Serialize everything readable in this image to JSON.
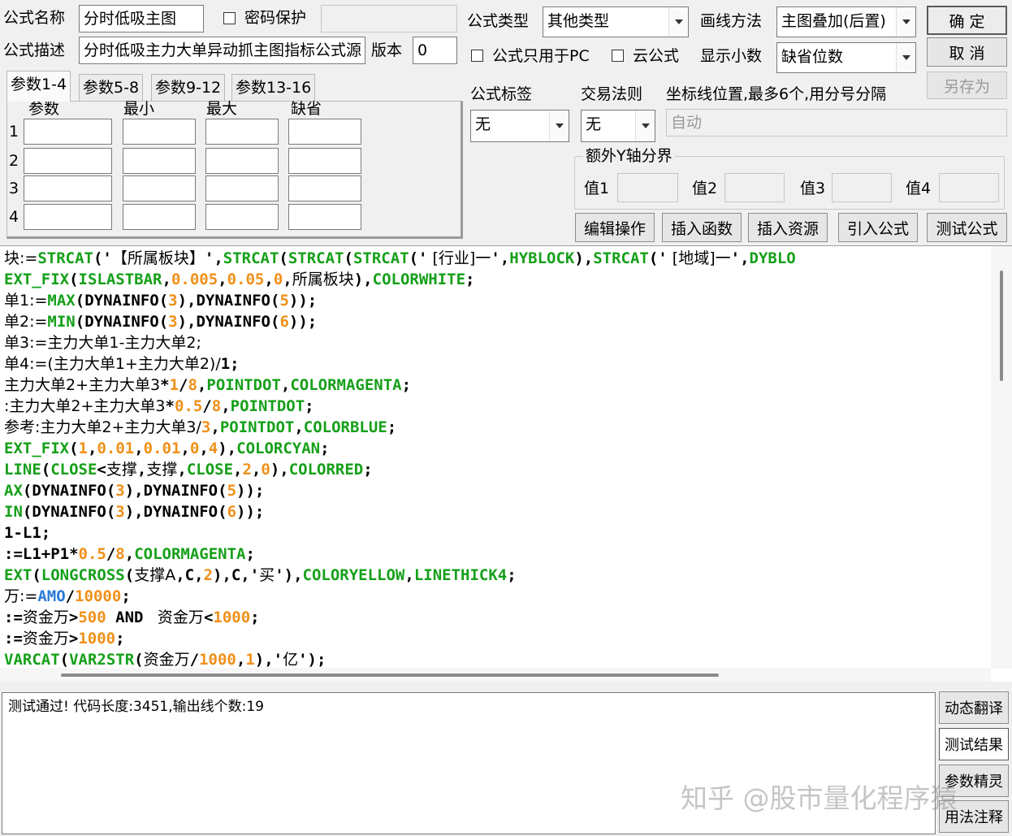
{
  "form": {
    "name_label": "公式名称",
    "name_value": "分时低吸主图",
    "password_label": "密码保护",
    "password_value": "",
    "desc_label": "公式描述",
    "desc_value": "分时低吸主力大单异动抓主图指标公式源",
    "version_label": "版本",
    "version_value": "0",
    "type_label": "公式类型",
    "type_value": "其他类型",
    "draw_label": "画线方法",
    "draw_value": "主图叠加(后置)",
    "pc_only_label": "公式只用于PC",
    "cloud_label": "云公式",
    "decimals_label": "显示小数",
    "decimals_value": "缺省位数"
  },
  "buttons": {
    "ok": "确  定",
    "cancel": "取  消",
    "save_as": "另存为"
  },
  "tabs": [
    "参数1-4",
    "参数5-8",
    "参数9-12",
    "参数13-16"
  ],
  "params": {
    "headers": [
      "参数",
      "最小",
      "最大",
      "缺省"
    ],
    "rows": [
      "1",
      "2",
      "3",
      "4"
    ]
  },
  "tag": {
    "label": "公式标签",
    "value": "无"
  },
  "trade_rule": {
    "label": "交易法则",
    "value": "无"
  },
  "axis": {
    "label": "坐标线位置,最多6个,用分号分隔",
    "placeholder": "自动"
  },
  "y_bounds": {
    "title": "额外Y轴分界",
    "labels": [
      "值1",
      "值2",
      "值3",
      "值4"
    ]
  },
  "tools": [
    "编辑操作",
    "插入函数",
    "插入资源",
    "引入公式",
    "测试公式"
  ],
  "code_lines": [
    [
      [
        "k",
        "t",
        "块:="
      ],
      [
        "g",
        "",
        "STRCAT"
      ],
      [
        "k",
        "",
        "('"
      ],
      [
        "k",
        "t",
        "【所属板块】"
      ],
      [
        "k",
        "",
        "',"
      ],
      [
        "g",
        "",
        "STRCAT"
      ],
      [
        "k",
        "",
        "("
      ],
      [
        "g",
        "",
        "STRCAT"
      ],
      [
        "k",
        "",
        "("
      ],
      [
        "g",
        "",
        "STRCAT"
      ],
      [
        "k",
        "",
        "('"
      ],
      [
        "k",
        "t",
        " [行业]一"
      ],
      [
        "k",
        "",
        "',"
      ],
      [
        "g",
        "",
        "HYBLOCK"
      ],
      [
        "k",
        "",
        "),"
      ],
      [
        "g",
        "",
        "STRCAT"
      ],
      [
        "k",
        "",
        "('"
      ],
      [
        "k",
        "t",
        " [地域]一"
      ],
      [
        "k",
        "",
        "',"
      ],
      [
        "g",
        "",
        "DYBLO"
      ]
    ],
    [
      [
        "g",
        "",
        "EXT_FIX"
      ],
      [
        "k",
        "",
        "("
      ],
      [
        "g",
        "",
        "ISLASTBAR"
      ],
      [
        "k",
        "",
        ","
      ],
      [
        "o",
        "",
        "0.005"
      ],
      [
        "k",
        "",
        ","
      ],
      [
        "o",
        "",
        "0.05"
      ],
      [
        "k",
        "",
        ","
      ],
      [
        "o",
        "",
        "0"
      ],
      [
        "k",
        "",
        ","
      ],
      [
        "k",
        "t",
        "所属板块"
      ],
      [
        "k",
        "",
        "),"
      ],
      [
        "g",
        "",
        "COLORWHITE"
      ],
      [
        "k",
        "",
        ";"
      ]
    ],
    [
      [
        "k",
        "t",
        "单1:="
      ],
      [
        "g",
        "",
        "MAX"
      ],
      [
        "k",
        "",
        "(DYNAINFO("
      ],
      [
        "o",
        "",
        "3"
      ],
      [
        "k",
        "",
        "),DYNAINFO("
      ],
      [
        "o",
        "",
        "5"
      ],
      [
        "k",
        "",
        "));"
      ]
    ],
    [
      [
        "k",
        "t",
        "单2:="
      ],
      [
        "g",
        "",
        "MIN"
      ],
      [
        "k",
        "",
        "(DYNAINFO("
      ],
      [
        "o",
        "",
        "3"
      ],
      [
        "k",
        "",
        "),DYNAINFO("
      ],
      [
        "o",
        "",
        "6"
      ],
      [
        "k",
        "",
        "));"
      ]
    ],
    [
      [
        "k",
        "t",
        "单3:=主力大单1-主力大单2;"
      ]
    ],
    [
      [
        "k",
        "t",
        "单4:=(主力大单1+主力大单2)/"
      ],
      [
        "k",
        "",
        "1;"
      ]
    ],
    [
      [
        "k",
        "t",
        "主力大单2+主力大单3"
      ],
      [
        "k",
        "",
        "*"
      ],
      [
        "o",
        "",
        "1"
      ],
      [
        "k",
        "",
        "/"
      ],
      [
        "o",
        "",
        "8"
      ],
      [
        "k",
        "",
        ","
      ],
      [
        "g",
        "",
        "POINTDOT"
      ],
      [
        "k",
        "",
        ","
      ],
      [
        "g",
        "",
        "COLORMAGENTA"
      ],
      [
        "k",
        "",
        ";"
      ]
    ],
    [
      [
        "k",
        "t",
        ":主力大单2+主力大单3"
      ],
      [
        "k",
        "",
        "*"
      ],
      [
        "o",
        "",
        "0.5"
      ],
      [
        "k",
        "",
        "/"
      ],
      [
        "o",
        "",
        "8"
      ],
      [
        "k",
        "",
        ","
      ],
      [
        "g",
        "",
        "POINTDOT"
      ],
      [
        "k",
        "",
        ";"
      ]
    ],
    [
      [
        "k",
        "t",
        "参考:主力大单2+主力大单3/"
      ],
      [
        "o",
        "",
        "3"
      ],
      [
        "k",
        "",
        ","
      ],
      [
        "g",
        "",
        "POINTDOT"
      ],
      [
        "k",
        "",
        ","
      ],
      [
        "g",
        "",
        "COLORBLUE"
      ],
      [
        "k",
        "",
        ";"
      ]
    ],
    [
      [
        "g",
        "",
        "EXT_FIX"
      ],
      [
        "k",
        "",
        "("
      ],
      [
        "o",
        "",
        "1"
      ],
      [
        "k",
        "",
        ","
      ],
      [
        "o",
        "",
        "0.01"
      ],
      [
        "k",
        "",
        ","
      ],
      [
        "o",
        "",
        "0.01"
      ],
      [
        "k",
        "",
        ","
      ],
      [
        "o",
        "",
        "0"
      ],
      [
        "k",
        "",
        ","
      ],
      [
        "o",
        "",
        "4"
      ],
      [
        "k",
        "",
        "),"
      ],
      [
        "g",
        "",
        "COLORCYAN"
      ],
      [
        "k",
        "",
        ";"
      ]
    ],
    [
      [
        "g",
        "",
        "LINE"
      ],
      [
        "k",
        "",
        "("
      ],
      [
        "g",
        "",
        "CLOSE"
      ],
      [
        "k",
        "",
        "<"
      ],
      [
        "k",
        "t",
        "支撑"
      ],
      [
        "k",
        "",
        ","
      ],
      [
        "k",
        "t",
        "支撑"
      ],
      [
        "k",
        "",
        ","
      ],
      [
        "g",
        "",
        "CLOSE"
      ],
      [
        "k",
        "",
        ","
      ],
      [
        "o",
        "",
        "2"
      ],
      [
        "k",
        "",
        ","
      ],
      [
        "o",
        "",
        "0"
      ],
      [
        "k",
        "",
        "),"
      ],
      [
        "g",
        "",
        "COLORRED"
      ],
      [
        "k",
        "",
        ";"
      ]
    ],
    [
      [
        "g",
        "",
        "AX"
      ],
      [
        "k",
        "",
        "(DYNAINFO("
      ],
      [
        "o",
        "",
        "3"
      ],
      [
        "k",
        "",
        "),DYNAINFO("
      ],
      [
        "o",
        "",
        "5"
      ],
      [
        "k",
        "",
        "));"
      ]
    ],
    [
      [
        "g",
        "",
        "IN"
      ],
      [
        "k",
        "",
        "(DYNAINFO("
      ],
      [
        "o",
        "",
        "3"
      ],
      [
        "k",
        "",
        "),DYNAINFO("
      ],
      [
        "o",
        "",
        "6"
      ],
      [
        "k",
        "",
        "));"
      ]
    ],
    [
      [
        "k",
        "",
        "1-L1;"
      ]
    ],
    [
      [
        "k",
        "",
        ":=L1+P1*"
      ],
      [
        "o",
        "",
        "0.5"
      ],
      [
        "k",
        "",
        "/"
      ],
      [
        "o",
        "",
        "8"
      ],
      [
        "k",
        "",
        ","
      ],
      [
        "g",
        "",
        "COLORMAGENTA"
      ],
      [
        "k",
        "",
        ";"
      ]
    ],
    [
      [
        "g",
        "",
        "EXT"
      ],
      [
        "k",
        "",
        "("
      ],
      [
        "g",
        "",
        "LONGCROSS"
      ],
      [
        "k",
        "",
        "("
      ],
      [
        "k",
        "t",
        "支撑A"
      ],
      [
        "k",
        "",
        ",C,"
      ],
      [
        "o",
        "",
        "2"
      ],
      [
        "k",
        "",
        "),C,'"
      ],
      [
        "k",
        "t",
        "买"
      ],
      [
        "k",
        "",
        "'),"
      ],
      [
        "g",
        "",
        "COLORYELLOW"
      ],
      [
        "k",
        "",
        ","
      ],
      [
        "g",
        "",
        "LINETHICK4"
      ],
      [
        "k",
        "",
        ";"
      ]
    ],
    [
      [
        "k",
        "t",
        "万:="
      ],
      [
        "b",
        "",
        "AMO"
      ],
      [
        "k",
        "",
        "/"
      ],
      [
        "o",
        "",
        "10000"
      ],
      [
        "k",
        "",
        ";"
      ]
    ],
    [
      [
        "k",
        "",
        ":="
      ],
      [
        "k",
        "t",
        "资金万"
      ],
      [
        "k",
        "",
        ">"
      ],
      [
        "o",
        "",
        "500"
      ],
      [
        "k",
        "",
        "",
        " AND "
      ],
      [
        "k",
        "t",
        " 资金万"
      ],
      [
        "k",
        "",
        "<"
      ],
      [
        "o",
        "",
        "1000"
      ],
      [
        "k",
        "",
        ";"
      ]
    ],
    [
      [
        "k",
        "",
        ":="
      ],
      [
        "k",
        "t",
        "资金万"
      ],
      [
        "k",
        "",
        ">"
      ],
      [
        "o",
        "",
        "1000"
      ],
      [
        "k",
        "",
        ";"
      ]
    ],
    [
      [
        "g",
        "",
        "VARCAT"
      ],
      [
        "k",
        "",
        "("
      ],
      [
        "g",
        "",
        "VAR2STR"
      ],
      [
        "k",
        "",
        "("
      ],
      [
        "k",
        "t",
        "资金万"
      ],
      [
        "k",
        "",
        "/"
      ],
      [
        "o",
        "",
        "1000"
      ],
      [
        "k",
        "",
        ","
      ],
      [
        "o",
        "",
        "1"
      ],
      [
        "k",
        "",
        "),'"
      ],
      [
        "k",
        "t",
        "亿"
      ],
      [
        "k",
        "",
        "');"
      ]
    ]
  ],
  "output_text": "测试通过! 代码长度:3451,输出线个数:19",
  "side_buttons": [
    "动态翻译",
    "测试结果",
    "参数精灵",
    "用法注释"
  ],
  "watermark": "知乎 @股市量化程序猿"
}
